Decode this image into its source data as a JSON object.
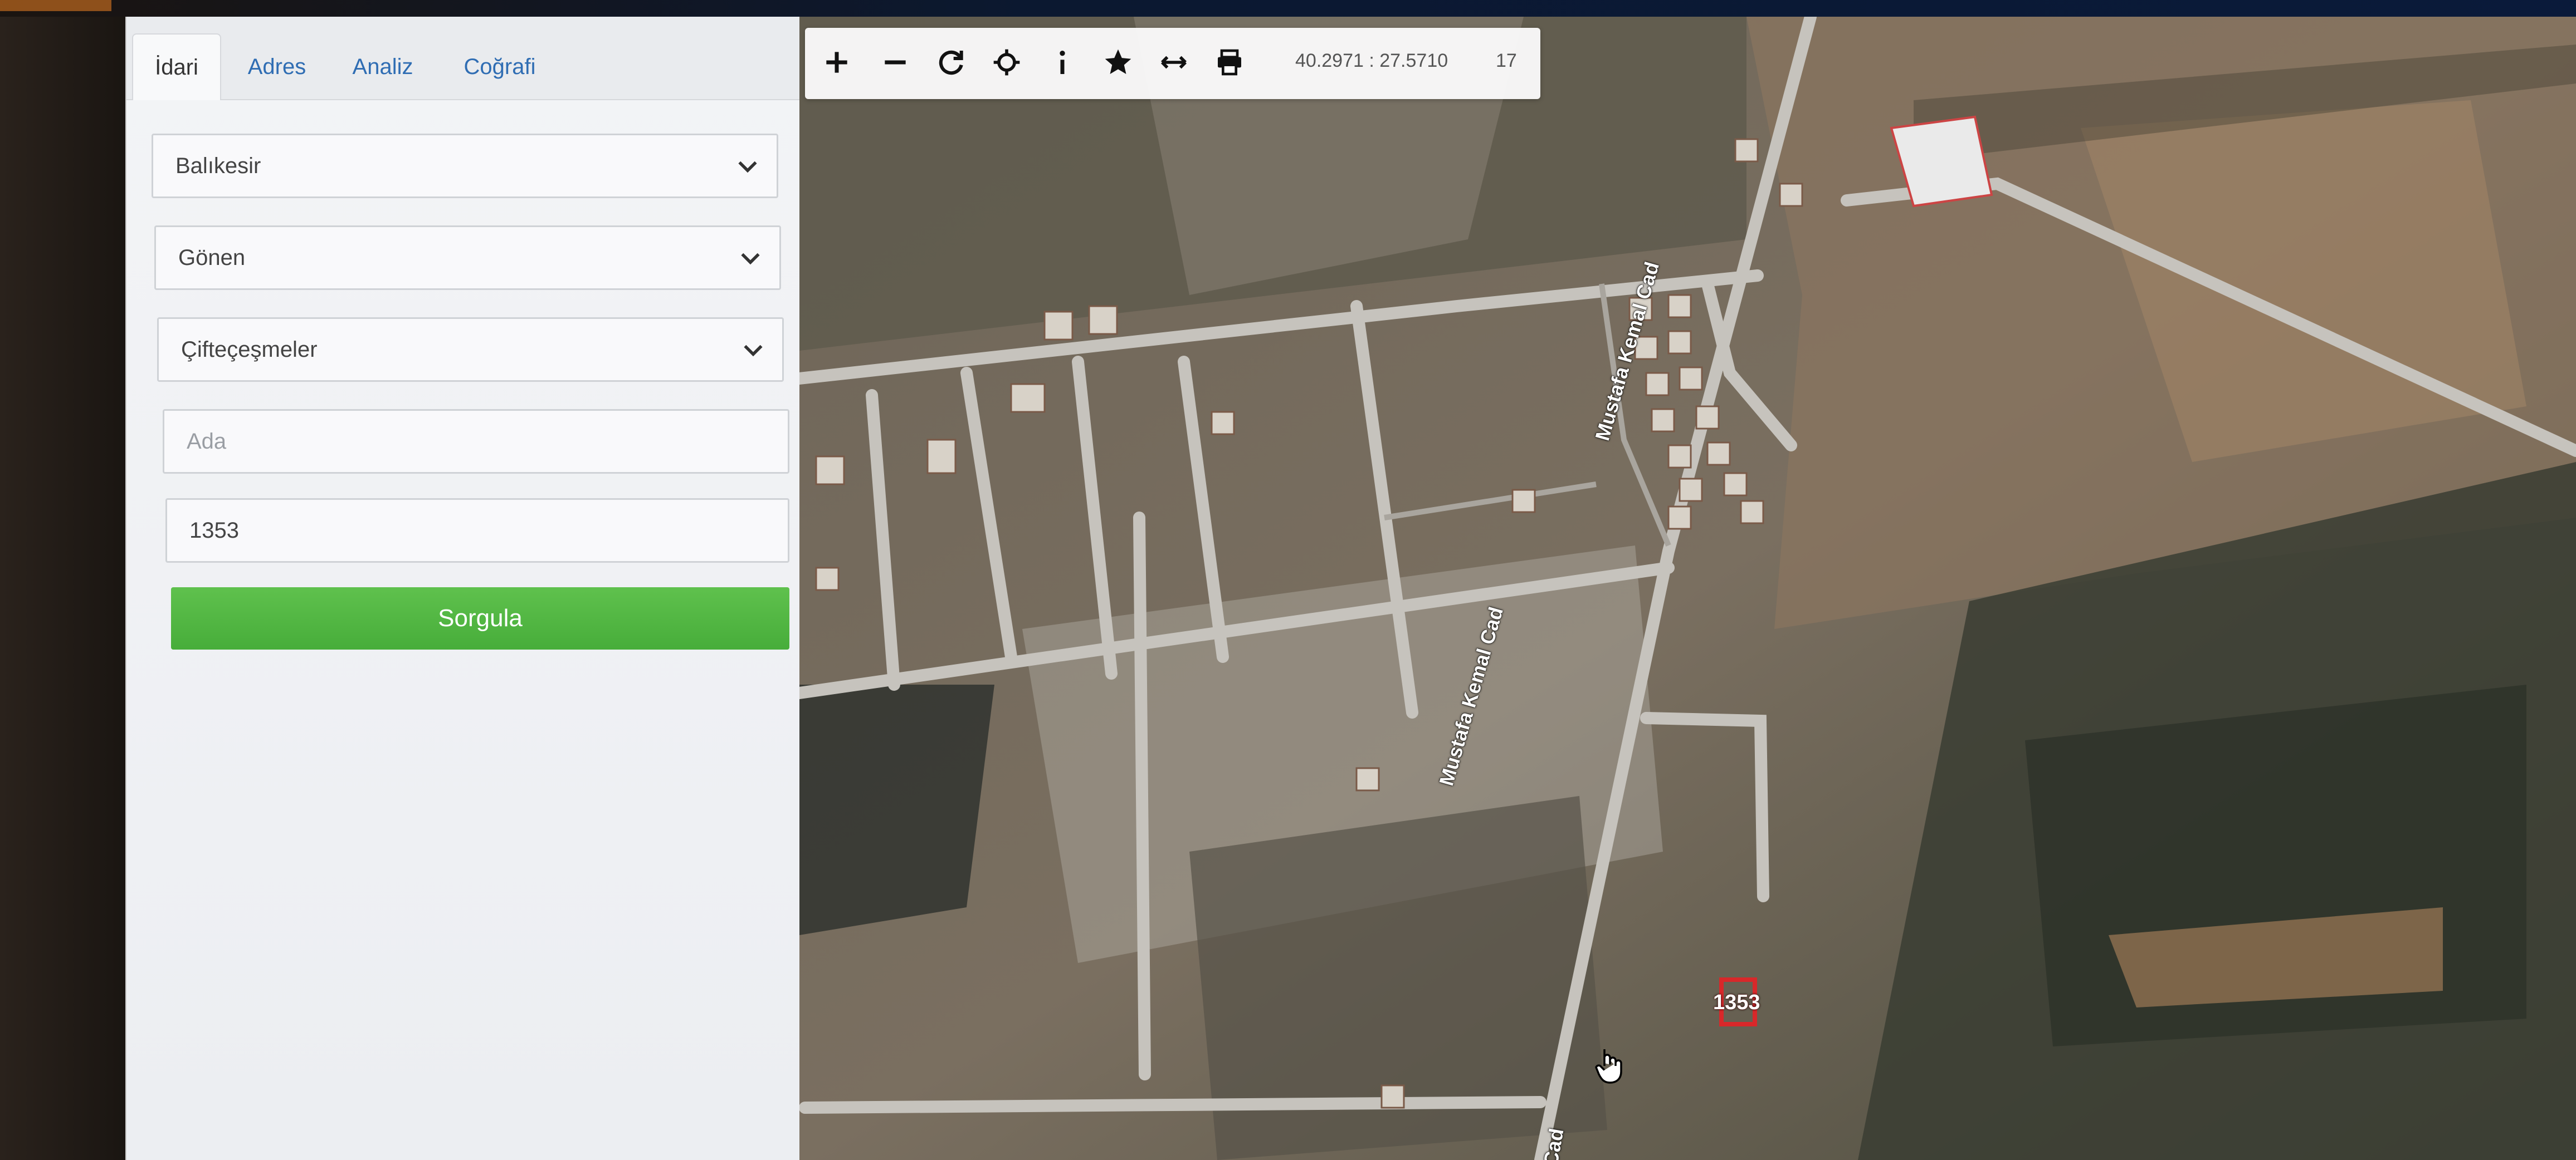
{
  "sidebar": {
    "tabs": [
      {
        "label": "İdari"
      },
      {
        "label": "Adres"
      },
      {
        "label": "Analiz"
      },
      {
        "label": "Coğrafi"
      }
    ],
    "province_select": {
      "value": "Balıkesir"
    },
    "district_select": {
      "value": "Gönen"
    },
    "neighborhood_select": {
      "value": "Çifteçeşmeler"
    },
    "ada_input": {
      "value": "",
      "placeholder": "Ada"
    },
    "parsel_input": {
      "value": "1353"
    },
    "query_button": {
      "label": "Sorgula"
    }
  },
  "toolbar": {
    "tools": [
      {
        "icon": "zoom-in-icon"
      },
      {
        "icon": "zoom-out-icon"
      },
      {
        "icon": "refresh-icon"
      },
      {
        "icon": "locate-icon"
      },
      {
        "icon": "info-icon"
      },
      {
        "icon": "star-icon"
      },
      {
        "icon": "measure-icon"
      },
      {
        "icon": "print-icon"
      }
    ],
    "coordinates": "40.2971 : 27.5710",
    "zoom_level": "17"
  },
  "map": {
    "road_labels": [
      "Mustafa Kemal Cad",
      "Mustafa Kemal Cad",
      "Cad"
    ],
    "parcel_label": "1353",
    "cursor": "hand-cursor-icon"
  },
  "colors": {
    "accent_green": "#4fb641",
    "link_blue": "#2f6db3",
    "parcel_red": "#d8282a"
  }
}
